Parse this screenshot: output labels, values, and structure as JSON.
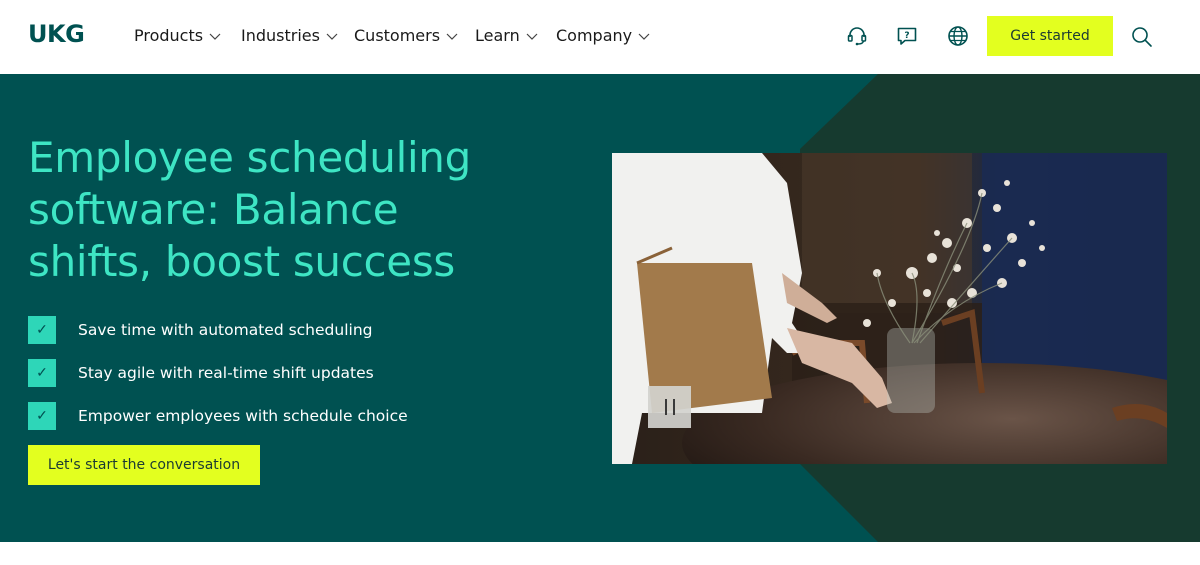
{
  "header": {
    "logo": "UKG",
    "nav": [
      {
        "label": "Products"
      },
      {
        "label": "Industries"
      },
      {
        "label": "Customers"
      },
      {
        "label": "Learn"
      },
      {
        "label": "Company"
      }
    ],
    "icons": [
      "support-icon",
      "chat-help-icon",
      "globe-icon",
      "search-icon"
    ],
    "get_started_label": "Get started"
  },
  "hero": {
    "title": "Employee scheduling software: Balance shifts, boost success",
    "features": [
      {
        "text": "Save time with automated scheduling"
      },
      {
        "text": "Stay agile with real-time shift updates"
      },
      {
        "text": "Empower employees with schedule choice"
      }
    ],
    "cta_label": "Let's start the conversation",
    "media": {
      "image": "server-arranging-flowers-on-table-photo",
      "control": "pause-icon"
    }
  },
  "colors": {
    "brand_teal": "#005151",
    "dark_green": "#163a2f",
    "accent_mint": "#3ee5c4",
    "check_mint": "#2ed6b8",
    "cta_yellow": "#e3ff1f"
  }
}
